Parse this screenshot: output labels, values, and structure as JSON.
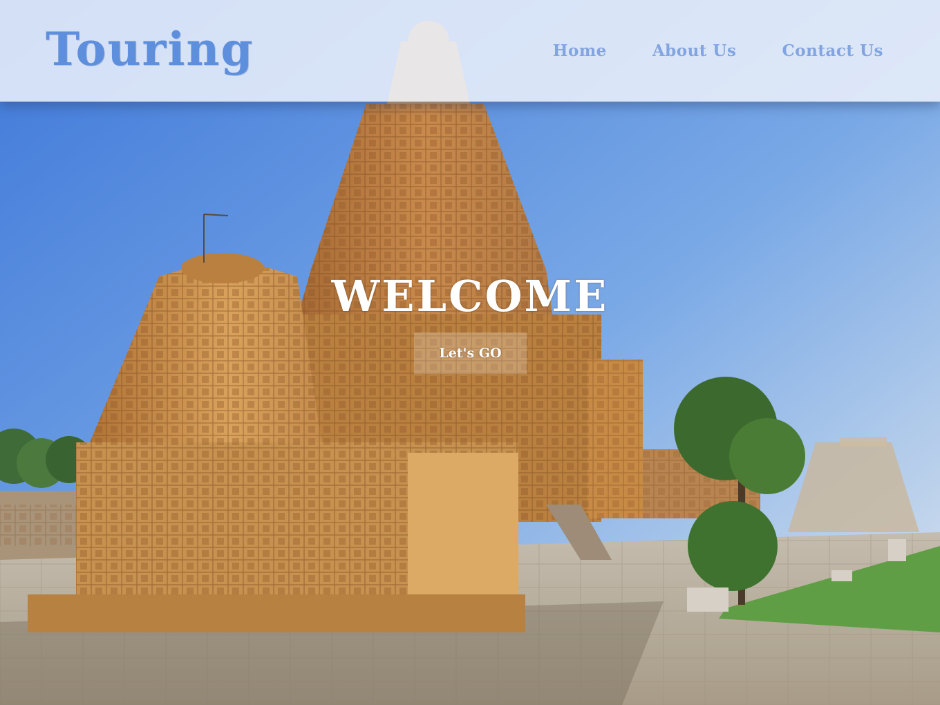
{
  "header": {
    "logo": "Touring",
    "nav": [
      {
        "label": "Home"
      },
      {
        "label": "About Us"
      },
      {
        "label": "Contact Us"
      }
    ]
  },
  "hero": {
    "title": "WELCOME",
    "cta_label": "Let's GO"
  },
  "colors": {
    "accent": "#5d8fdc",
    "nav": "#82a4e0",
    "header_bg": "#ecf1fa"
  }
}
